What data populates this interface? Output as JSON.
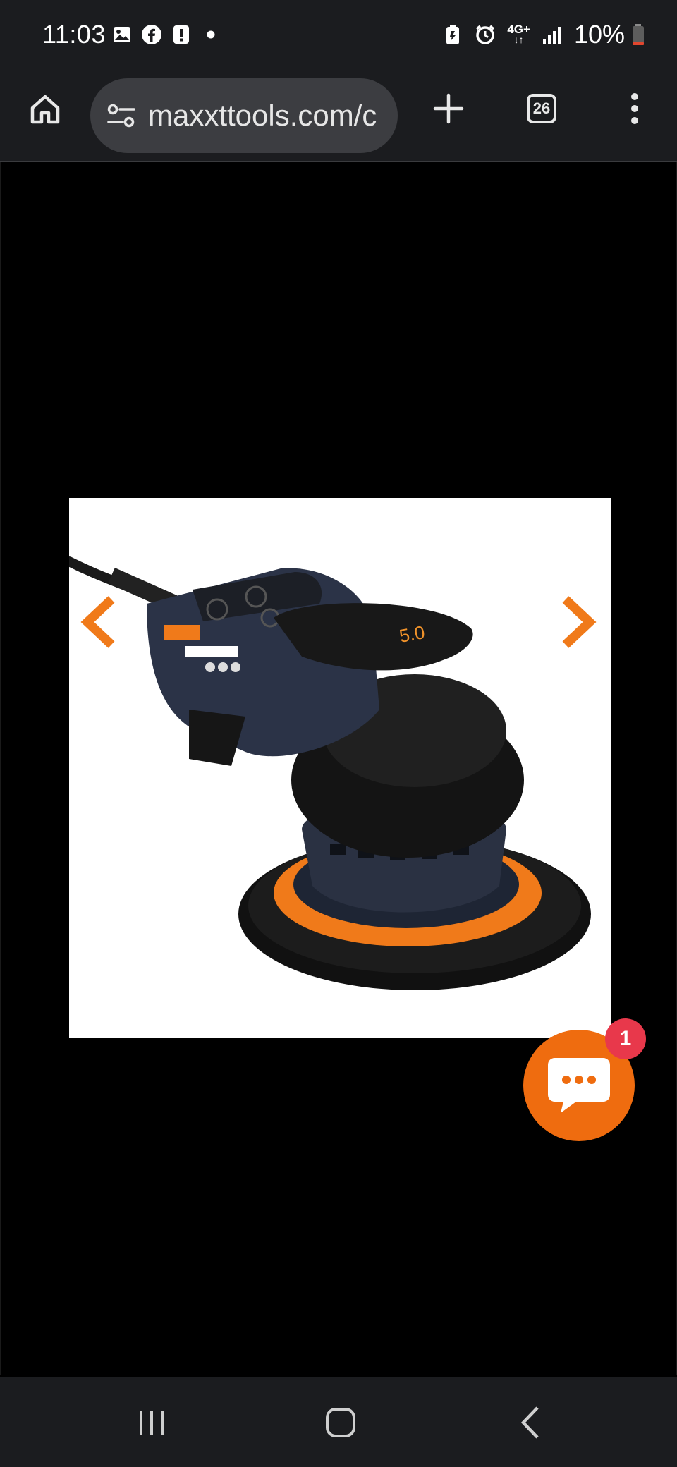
{
  "status_bar": {
    "time": "11:03",
    "network": "4G+",
    "battery": "10%",
    "left_icons": [
      "image-icon",
      "facebook-icon",
      "alert-icon",
      "dot-icon"
    ],
    "right_icons": [
      "battery-saver-icon",
      "alarm-icon",
      "signal-icon",
      "battery-icon"
    ]
  },
  "browser": {
    "url": "maxxttools.com/c",
    "tab_count": "26"
  },
  "slider": {
    "image_description_icon": "orbital-sander-image"
  },
  "chat": {
    "badge_count": "1"
  },
  "colors": {
    "accent": "#ef6c0f",
    "badge": "#e8384b",
    "chrome": "#1b1c1f",
    "omnibox": "#3c3d41"
  }
}
